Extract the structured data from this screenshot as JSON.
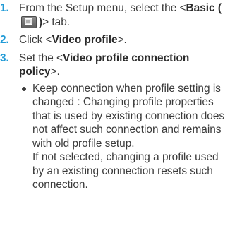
{
  "steps": [
    {
      "number": "1.",
      "text_before": "From the Setup menu, select the <",
      "bold_label": "Basic (",
      "icon": "basic-setup-icon",
      "bold_label_end": ")",
      "text_after": "> tab."
    },
    {
      "number": "2.",
      "text_before": "Click <",
      "bold_label": "Video profile",
      "text_after": ">."
    },
    {
      "number": "3.",
      "text_before": "Set the <",
      "bold_label": "Video profile connection policy",
      "text_after": ">.",
      "bullets": [
        {
          "paragraph_1": "Keep connection when profile setting is changed : Changing profile properties that is used by existing connection does not affect such connection and remains with old profile setup.",
          "paragraph_2": "If not selected, changing a profile used by an existing connection resets such connection."
        }
      ]
    }
  ],
  "colors": {
    "step_number": "#1f9ad6",
    "body_text": "#3a3a3a",
    "icon_fill": "#6e6e6e"
  }
}
